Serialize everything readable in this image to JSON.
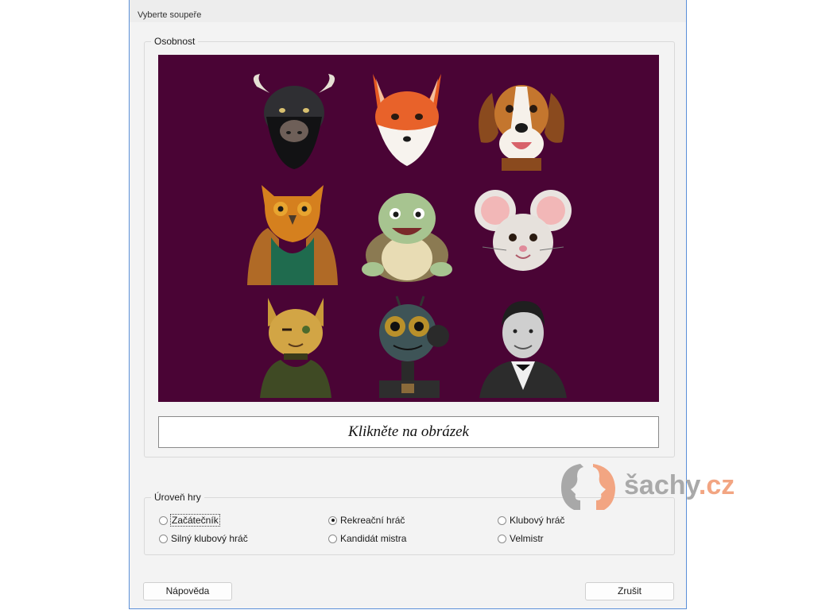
{
  "window": {
    "title": "Vyberte soupeře"
  },
  "personality": {
    "group_label": "Osobnost",
    "portraits": [
      {
        "name": "bull-portrait"
      },
      {
        "name": "fox-portrait"
      },
      {
        "name": "dog-portrait"
      },
      {
        "name": "owl-portrait"
      },
      {
        "name": "turtle-portrait"
      },
      {
        "name": "mouse-portrait"
      },
      {
        "name": "cat-portrait"
      },
      {
        "name": "robot-portrait"
      },
      {
        "name": "man-portrait"
      }
    ],
    "caption": "Klikněte na obrázek",
    "background_color": "#4a0435"
  },
  "level": {
    "group_label": "Úroveň hry",
    "options": [
      {
        "label": "Začátečník",
        "checked": false,
        "focused": true
      },
      {
        "label": "Rekreační hráč",
        "checked": true,
        "focused": false
      },
      {
        "label": "Klubový hráč",
        "checked": false,
        "focused": false
      },
      {
        "label": "Silný klubový hráč",
        "checked": false,
        "focused": false
      },
      {
        "label": "Kandidát mistra",
        "checked": false,
        "focused": false
      },
      {
        "label": "Velmistr",
        "checked": false,
        "focused": false
      }
    ]
  },
  "buttons": {
    "help": "Nápověda",
    "cancel": "Zrušit"
  },
  "watermark": {
    "text_part1": "šachy",
    "text_part2": ".cz"
  }
}
